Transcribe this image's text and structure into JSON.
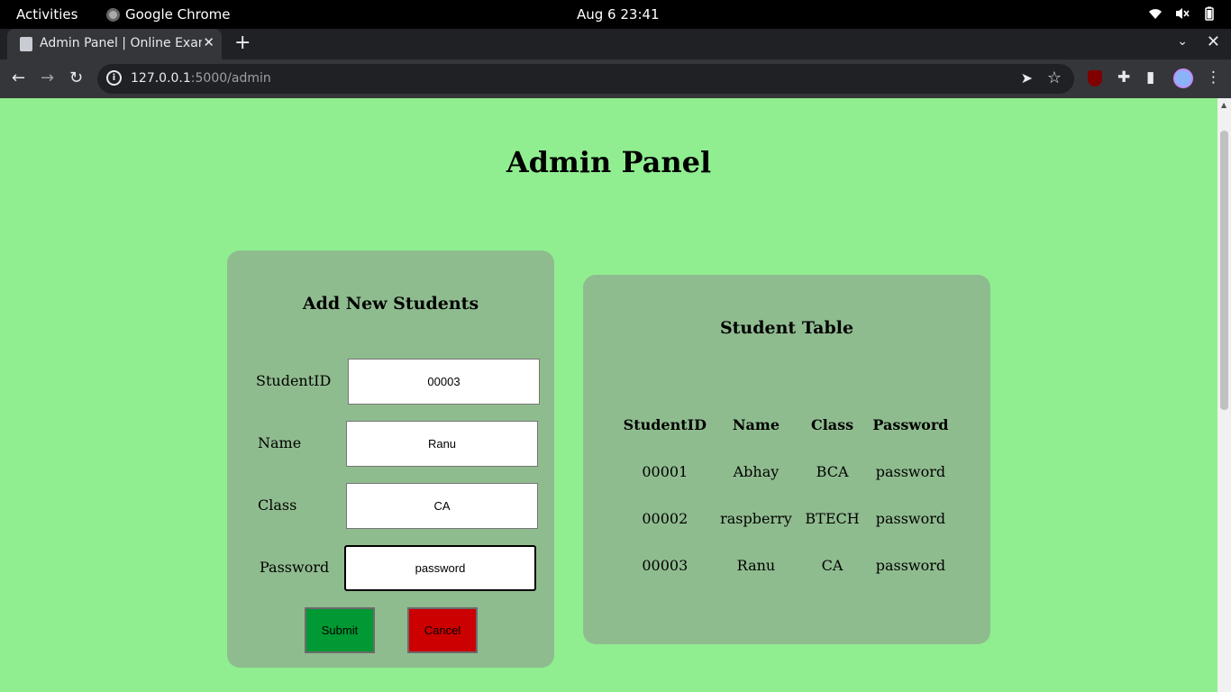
{
  "system": {
    "activities": "Activities",
    "app_name": "Google Chrome",
    "clock": "Aug 6  23:41"
  },
  "browser": {
    "tab_title": "Admin Panel | Online Exam",
    "url_host": "127.0.0.1",
    "url_path": ":5000/admin"
  },
  "page": {
    "title": "Admin Panel",
    "form": {
      "heading": "Add New Students",
      "fields": {
        "student_id": {
          "label": "StudentID",
          "value": "00003"
        },
        "name": {
          "label": "Name",
          "value": "Ranu"
        },
        "class": {
          "label": "Class",
          "value": "CA"
        },
        "password": {
          "label": "Password",
          "value": "password"
        }
      },
      "submit_label": "Submit",
      "cancel_label": "Cancel"
    },
    "table": {
      "heading": "Student Table",
      "columns": [
        "StudentID",
        "Name",
        "Class",
        "Password"
      ],
      "rows": [
        [
          "00001",
          "Abhay",
          "BCA",
          "password"
        ],
        [
          "00002",
          "raspberry",
          "BTECH",
          "password"
        ],
        [
          "00003",
          "Ranu",
          "CA",
          "password"
        ]
      ]
    }
  },
  "colors": {
    "page_background": "#90ee90",
    "card_background": "#8fbc8f",
    "submit_button": "#009933",
    "cancel_button": "#cc0000"
  }
}
